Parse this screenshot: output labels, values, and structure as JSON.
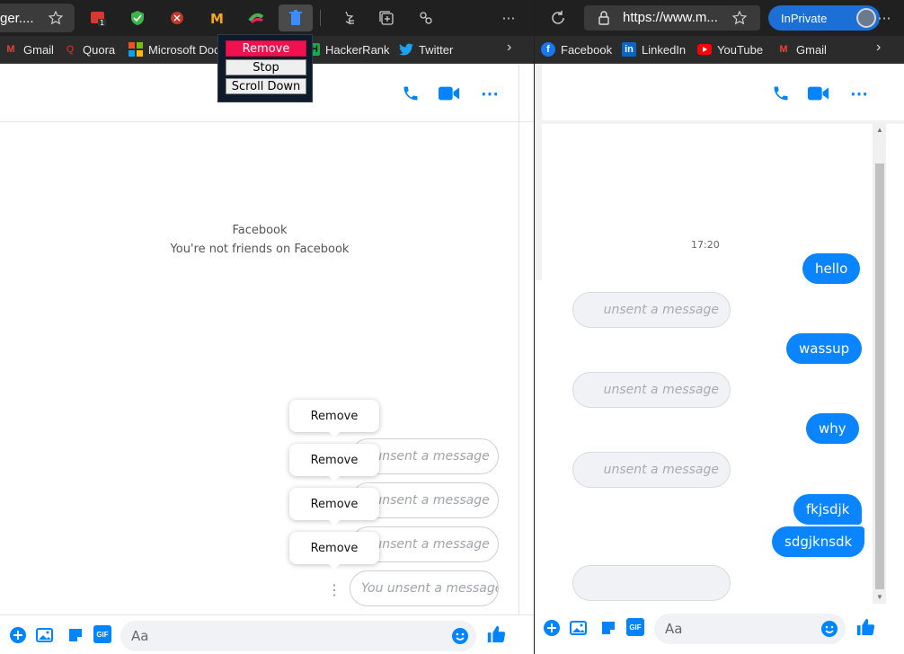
{
  "left_window": {
    "tab_title": "ger....",
    "bookmarks": [
      {
        "label": "Gmail",
        "icon": "gmail-icon"
      },
      {
        "label": "Quora",
        "icon": "quora-icon"
      },
      {
        "label": "Microsoft Doc",
        "icon": "microsoft-icon"
      },
      {
        "label": "HackerRank",
        "icon": "hackerrank-icon"
      },
      {
        "label": "Twitter",
        "icon": "twitter-icon"
      }
    ],
    "extension_popup": {
      "remove": "Remove",
      "stop": "Stop",
      "scroll_down": "Scroll Down"
    },
    "chat_info": {
      "title": "Facebook",
      "subtitle": "You're not friends on Facebook"
    },
    "tooltips": [
      "Remove",
      "Remove",
      "Remove",
      "Remove"
    ],
    "unsent_messages": [
      "u unsent a message",
      "u unsent a message",
      "u unsent a message",
      "You unsent a message"
    ],
    "composer_placeholder": "Aa",
    "gif_label": "GIF"
  },
  "right_window": {
    "url": "https://www.m...",
    "inprivate": "InPrivate",
    "bookmarks": [
      {
        "label": "Facebook",
        "icon": "facebook-icon"
      },
      {
        "label": "LinkedIn",
        "icon": "linkedin-icon"
      },
      {
        "label": "YouTube",
        "icon": "youtube-icon"
      },
      {
        "label": "Gmail",
        "icon": "gmail-icon"
      }
    ],
    "timestamp": "17:20",
    "messages": [
      {
        "from": "me",
        "text": "hello"
      },
      {
        "from": "them",
        "text": "unsent a message"
      },
      {
        "from": "me",
        "text": "wassup"
      },
      {
        "from": "them",
        "text": "unsent a message"
      },
      {
        "from": "me",
        "text": "why"
      },
      {
        "from": "them",
        "text": "unsent a message"
      },
      {
        "from": "me",
        "text": "fkjsdjk"
      },
      {
        "from": "me",
        "text": "sdgjknsdk"
      },
      {
        "from": "them",
        "text": ""
      }
    ],
    "composer_placeholder": "Aa",
    "gif_label": "GIF"
  },
  "colors": {
    "messenger_blue": "#0084ff",
    "bubble_blue": "#0a84ff",
    "remove_red": "#f0114f",
    "inprivate_blue": "#1b6fd6"
  }
}
